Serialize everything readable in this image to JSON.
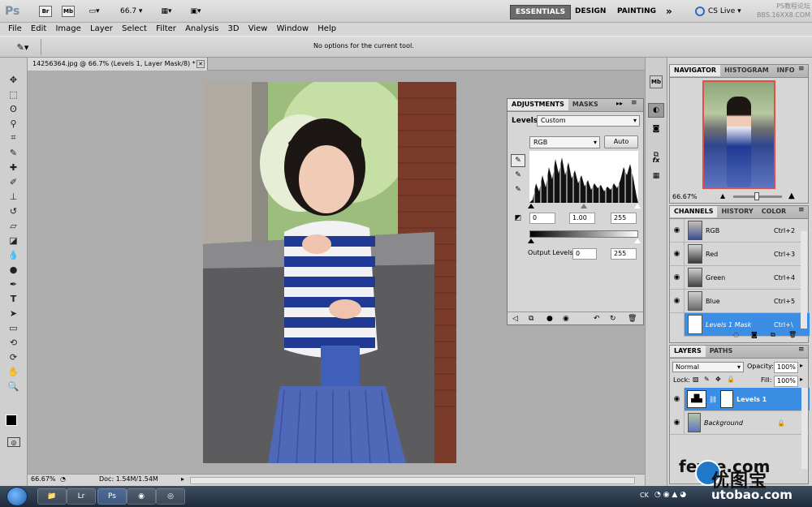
{
  "app": {
    "logo": "Ps",
    "zoom_value": "66.7",
    "workspaces": [
      "ESSENTIALS",
      "DESIGN",
      "PAINTING"
    ],
    "more_label": "»",
    "cs_live": "CS Live",
    "watermark_top": "PS教程论坛\nBBS.16XX8.COM"
  },
  "menu": [
    "File",
    "Edit",
    "Image",
    "Layer",
    "Select",
    "Filter",
    "Analysis",
    "3D",
    "View",
    "Window",
    "Help"
  ],
  "options_bar": {
    "message": "No options for the current tool."
  },
  "document": {
    "tab_title": "14256364.jpg @ 66.7% (Levels 1, Layer Mask/8) *",
    "zoom": "66.67%",
    "doc_size": "Doc: 1.54M/1.54M"
  },
  "adjustments": {
    "tabs": [
      "ADJUSTMENTS",
      "MASKS"
    ],
    "title": "Levels",
    "preset": "Custom",
    "channel": "RGB",
    "auto_label": "Auto",
    "input_black": "0",
    "input_gamma": "1.00",
    "input_white": "255",
    "output_label": "Output Levels:",
    "output_black": "0",
    "output_white": "255"
  },
  "navigator": {
    "tabs": [
      "NAVIGATOR",
      "HISTOGRAM",
      "INFO"
    ],
    "zoom": "66.67%"
  },
  "channels": {
    "tabs": [
      "CHANNELS",
      "HISTORY",
      "COLOR"
    ],
    "rows": [
      {
        "name": "RGB",
        "shortcut": "Ctrl+2"
      },
      {
        "name": "Red",
        "shortcut": "Ctrl+3"
      },
      {
        "name": "Green",
        "shortcut": "Ctrl+4"
      },
      {
        "name": "Blue",
        "shortcut": "Ctrl+5"
      },
      {
        "name": "Levels 1 Mask",
        "shortcut": "Ctrl+\\"
      }
    ]
  },
  "layers": {
    "tabs": [
      "LAYERS",
      "PATHS"
    ],
    "blend_mode": "Normal",
    "opacity_label": "Opacity:",
    "opacity": "100%",
    "lock_label": "Lock:",
    "fill_label": "Fill:",
    "fill": "100%",
    "rows": [
      {
        "name": "Levels 1"
      },
      {
        "name": "Background"
      }
    ]
  },
  "taskbar": {
    "tray_text": "CK",
    "watermark": "fevte.com",
    "watermark2": "优图宝",
    "watermark3": "utobao.com"
  },
  "colors": {
    "selection": "#3b8ee3",
    "workspace_active": "#6b6b6b"
  }
}
